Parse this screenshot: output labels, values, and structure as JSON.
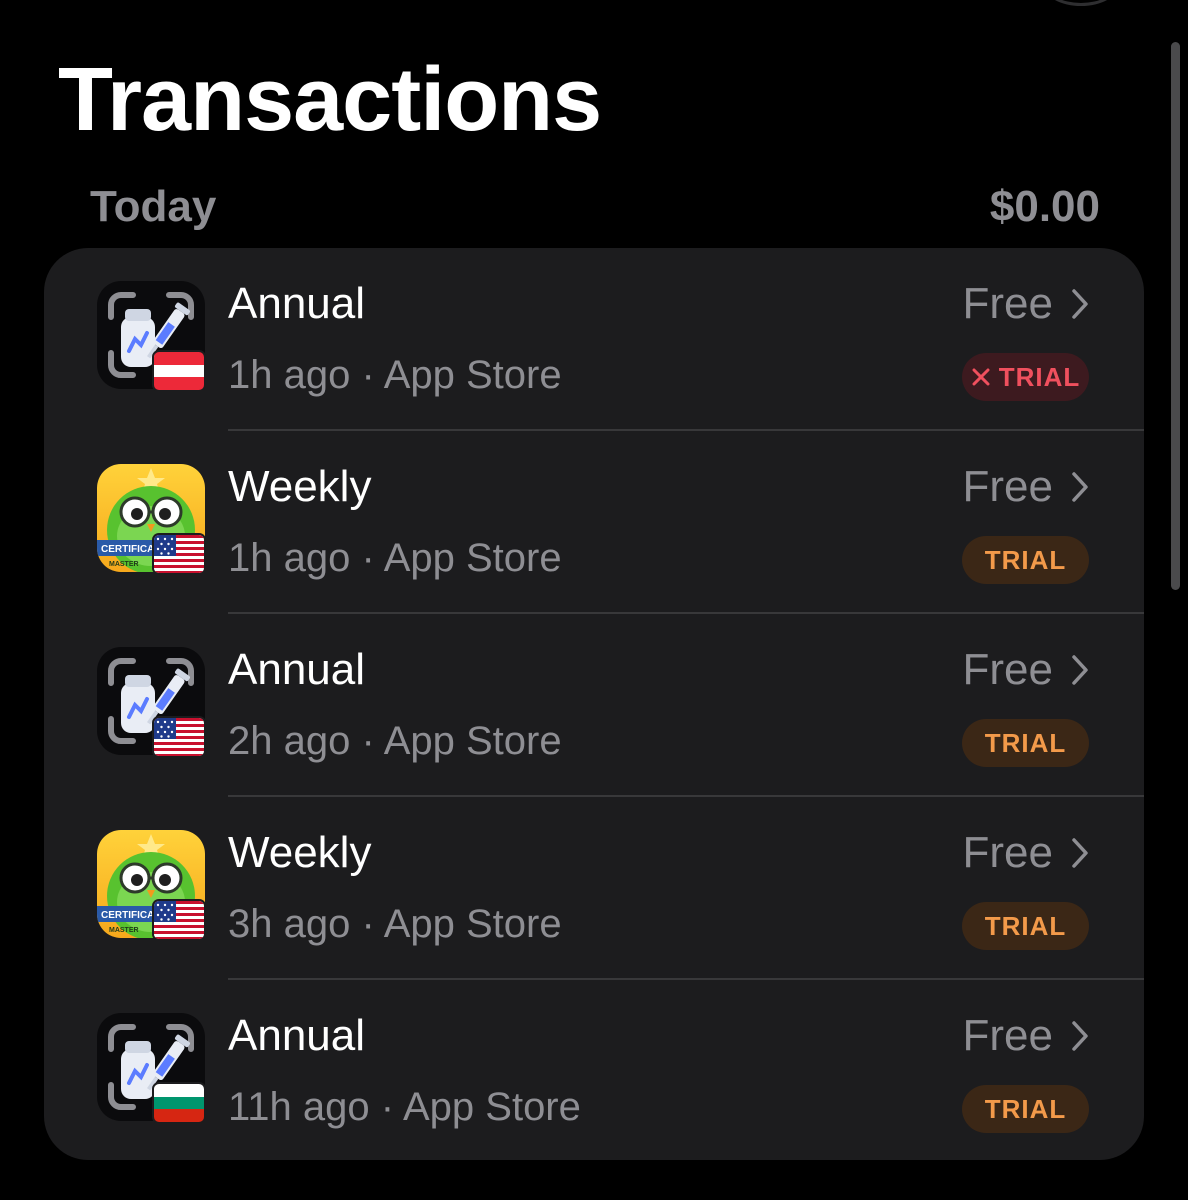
{
  "page_title": "Transactions",
  "section": {
    "label": "Today",
    "total": "$0.00"
  },
  "transactions": [
    {
      "plan": "Annual",
      "time": "1h ago",
      "separator": "·",
      "store": "App Store",
      "price": "Free",
      "badge": "TRIAL",
      "badge_state": "cancelled",
      "app_icon": "vaccine-tracker-app-icon",
      "flag": "austria-flag-icon"
    },
    {
      "plan": "Weekly",
      "time": "1h ago",
      "separator": "·",
      "store": "App Store",
      "price": "Free",
      "badge": "TRIAL",
      "badge_state": "trial",
      "app_icon": "owl-certificate-app-icon",
      "flag": "us-flag-icon"
    },
    {
      "plan": "Annual",
      "time": "2h ago",
      "separator": "·",
      "store": "App Store",
      "price": "Free",
      "badge": "TRIAL",
      "badge_state": "trial",
      "app_icon": "vaccine-tracker-app-icon",
      "flag": "us-flag-icon"
    },
    {
      "plan": "Weekly",
      "time": "3h ago",
      "separator": "·",
      "store": "App Store",
      "price": "Free",
      "badge": "TRIAL",
      "badge_state": "trial",
      "app_icon": "owl-certificate-app-icon",
      "flag": "us-flag-icon"
    },
    {
      "plan": "Annual",
      "time": "11h ago",
      "separator": "·",
      "store": "App Store",
      "price": "Free",
      "badge": "TRIAL",
      "badge_state": "trial",
      "app_icon": "vaccine-tracker-app-icon",
      "flag": "bulgaria-flag-icon"
    }
  ],
  "owl_icon_ribbon_text": "CERTIFICAT",
  "owl_icon_ribbon_subtext": "MASTER",
  "colors": {
    "background": "#000000",
    "card": "#1c1c1e",
    "secondary_text": "#8e8e93",
    "trial_badge_bg": "#3b2716",
    "trial_badge_text": "#f39a4a",
    "cancelled_badge_bg": "#3d1a1f",
    "cancelled_badge_text": "#f0505e"
  }
}
